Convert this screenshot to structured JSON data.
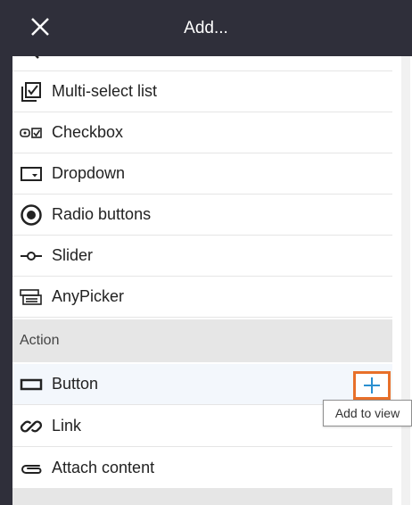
{
  "header": {
    "title": "Add...",
    "close_icon": "close-icon"
  },
  "items_top": [
    {
      "label": "Multi-select list",
      "icon": "multi-select-icon"
    },
    {
      "label": "Checkbox",
      "icon": "checkbox-icon"
    },
    {
      "label": "Dropdown",
      "icon": "dropdown-icon"
    },
    {
      "label": "Radio buttons",
      "icon": "radio-icon"
    },
    {
      "label": "Slider",
      "icon": "slider-icon"
    },
    {
      "label": "AnyPicker",
      "icon": "anypicker-icon"
    }
  ],
  "section_action": {
    "label": "Action"
  },
  "items_action": [
    {
      "label": "Button",
      "icon": "button-icon"
    },
    {
      "label": "Link",
      "icon": "link-icon"
    },
    {
      "label": "Attach content",
      "icon": "paperclip-icon"
    }
  ],
  "add_button": {
    "icon": "plus-icon",
    "tooltip": "Add to view"
  },
  "colors": {
    "header_bg": "#2f2f3a",
    "accent_plus": "#2a8fd0",
    "highlight_border": "#e8702a",
    "section_bg": "#e6e6e6"
  }
}
